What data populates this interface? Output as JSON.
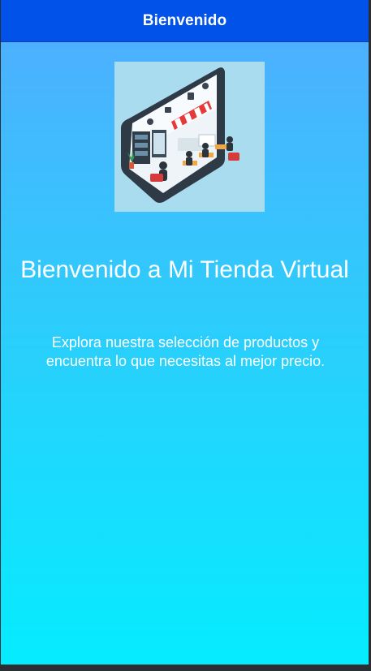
{
  "appbar": {
    "title": "Bienvenido"
  },
  "hero": {
    "image": "online-store-illustration"
  },
  "welcome": {
    "headline": "Bienvenido a Mi Tienda Virtual",
    "description": "Explora nuestra selección de productos y encuentra lo que necesitas al mejor precio."
  },
  "colors": {
    "appbar": "#0052e8",
    "gradient_top": "#4db0ff",
    "gradient_bottom": "#05ecff",
    "text": "#ffffff"
  }
}
